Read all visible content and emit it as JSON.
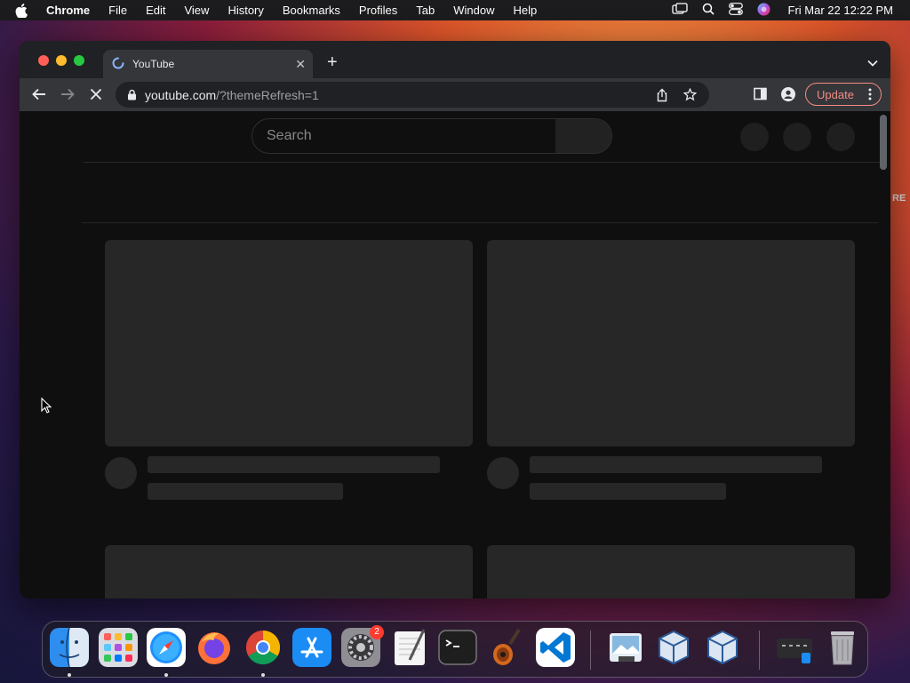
{
  "menubar": {
    "app": "Chrome",
    "items": [
      "File",
      "Edit",
      "View",
      "History",
      "Bookmarks",
      "Profiles",
      "Tab",
      "Window",
      "Help"
    ],
    "clock": "Fri Mar 22  12:22 PM"
  },
  "tab": {
    "title": "YouTube"
  },
  "omnibox": {
    "host": "youtube.com",
    "path": "/?themeRefresh=1"
  },
  "toolbar": {
    "update_label": "Update"
  },
  "page": {
    "search_placeholder": "Search"
  },
  "dock": {
    "settings_badge": "2"
  },
  "background": {
    "edge_text": "RE"
  },
  "colors": {
    "accent_update": "#f28b82",
    "traffic_red": "#ff5f57",
    "traffic_yellow": "#febc2e",
    "traffic_green": "#28c840"
  }
}
